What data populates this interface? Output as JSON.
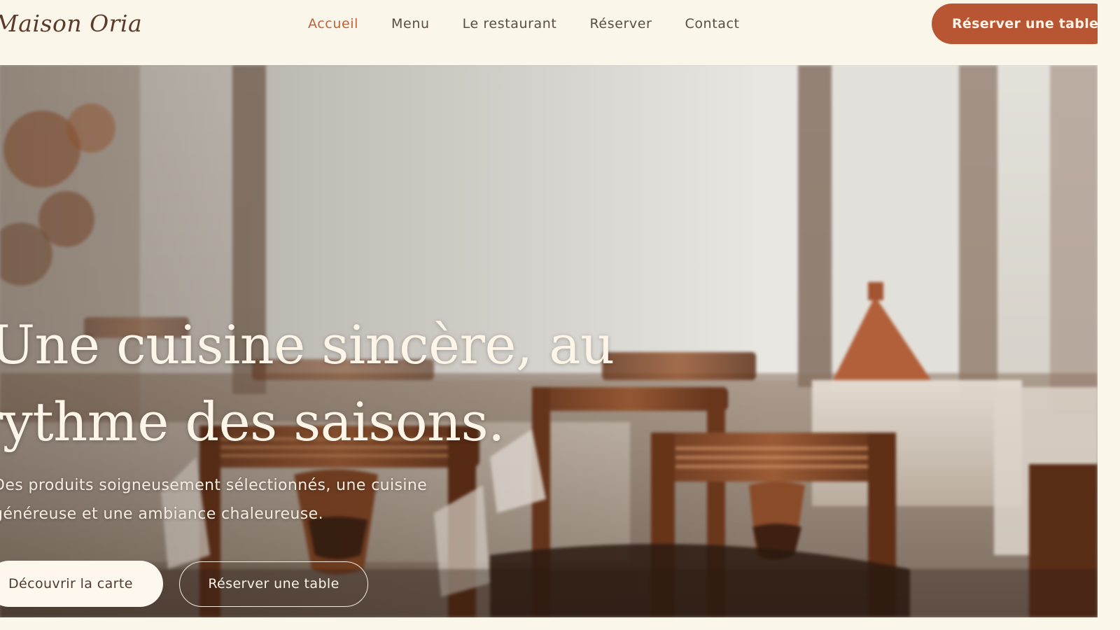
{
  "header": {
    "brand": "Maison Oria",
    "nav": [
      {
        "label": "Accueil",
        "active": true
      },
      {
        "label": "Menu"
      },
      {
        "label": "Le restaurant"
      },
      {
        "label": "Réserver"
      },
      {
        "label": "Contact"
      }
    ],
    "cta_label": "Réserver une table"
  },
  "hero": {
    "title_line1": "Une cuisine sincère, au",
    "title_line2": "rythme des saisons.",
    "subtitle_line1": "Des produits soigneusement sélectionnés, une cuisine",
    "subtitle_line2": "généreuse et une ambiance chaleureuse.",
    "primary_button": "Découvrir la carte",
    "secondary_button": "Réserver une table",
    "image_description_icon": "restaurant-dining-room-photo"
  },
  "colors": {
    "accent": "#b85634",
    "active_nav": "#c1603d",
    "background": "#fbf6ea",
    "text_dark": "#5a4c42"
  }
}
